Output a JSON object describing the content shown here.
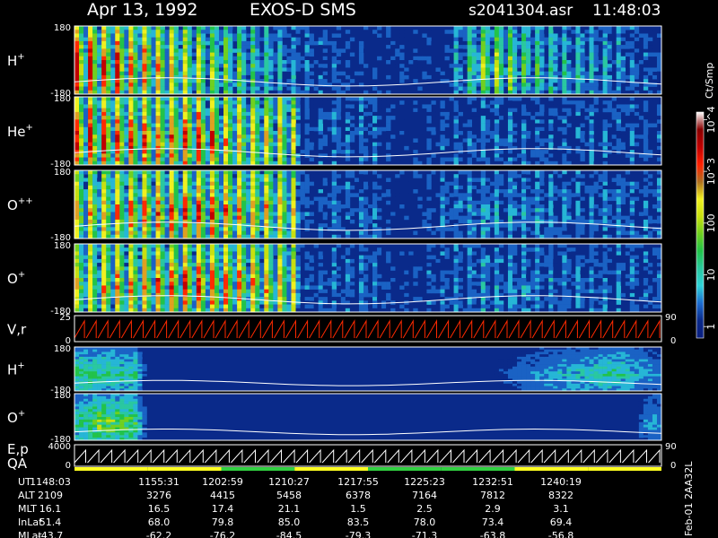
{
  "header": {
    "date": "Apr 13, 1992",
    "instrument": "EXOS-D SMS",
    "file": "s2041304.asr",
    "time": "11:48:03"
  },
  "colors": {
    "background": "#000000",
    "spectrogram_bg": "#0a2a8a",
    "trace": "#ffffff",
    "line_red": "#ff2a00"
  },
  "colorbar": {
    "unit": "Ct/Smp",
    "ticks": [
      {
        "label": "1",
        "value": 1
      },
      {
        "label": "10",
        "value": 10
      },
      {
        "label": "100",
        "value": 100
      },
      {
        "label": "10^3",
        "value": 1000
      },
      {
        "label": "10^4",
        "value": 10000
      }
    ],
    "range": [
      0.6,
      14000
    ],
    "stops": [
      "#0a1f80",
      "#0a2a8a",
      "#1d6cd0",
      "#2fd2d8",
      "#2ac8a0",
      "#22c34a",
      "#70d020",
      "#c8e010",
      "#f0f020",
      "#b07020",
      "#ff2000",
      "#c00000",
      "#880000",
      "#ffffff"
    ]
  },
  "chart_data": {
    "type": "heatmap",
    "x_time_labels": [
      "1148:03",
      "1155:31",
      "1202:59",
      "1210:27",
      "1217:55",
      "1225:23",
      "1232:51",
      "1240:19"
    ],
    "ephemeris": [
      {
        "label": "UT",
        "values": [
          "1148:03",
          "1155:31",
          "1202:59",
          "1210:27",
          "1217:55",
          "1225:23",
          "1232:51",
          "1240:19"
        ]
      },
      {
        "label": "ALT",
        "values": [
          "2109",
          "3276",
          "4415",
          "5458",
          "6378",
          "7164",
          "7812",
          "8322"
        ]
      },
      {
        "label": "MLT",
        "values": [
          "16.1",
          "16.5",
          "17.4",
          "21.1",
          "1.5",
          "2.5",
          "2.9",
          "3.1"
        ]
      },
      {
        "label": "InLat",
        "values": [
          "51.4",
          "68.0",
          "79.8",
          "85.0",
          "83.5",
          "78.0",
          "73.4",
          "69.4"
        ]
      },
      {
        "label": "MLat",
        "values": [
          "-43.7",
          "-62.2",
          "-76.2",
          "-84.5",
          "-79.3",
          "-71.3",
          "-63.8",
          "-56.8"
        ]
      }
    ],
    "panels": [
      {
        "label": "H",
        "sup": "+",
        "ytop": "180",
        "ybot": "-180",
        "kind": "spec",
        "profile": [
          [
            0.0,
            0.85
          ],
          [
            0.15,
            0.65
          ],
          [
            0.3,
            0.35
          ],
          [
            0.38,
            0.15
          ],
          [
            0.5,
            0.04
          ],
          [
            0.56,
            0.08
          ],
          [
            0.62,
            0.02
          ],
          [
            0.7,
            0.55
          ],
          [
            0.8,
            0.3
          ],
          [
            0.92,
            0.2
          ],
          [
            1.0,
            0.05
          ]
        ]
      },
      {
        "label": "He",
        "sup": "+",
        "ytop": "180",
        "ybot": "-180",
        "kind": "spec",
        "profile": [
          [
            0.0,
            0.8
          ],
          [
            0.15,
            0.7
          ],
          [
            0.2,
            0.8
          ],
          [
            0.25,
            0.65
          ],
          [
            0.37,
            0.55
          ],
          [
            0.38,
            0.1
          ],
          [
            0.5,
            0.15
          ],
          [
            0.55,
            0.02
          ],
          [
            0.68,
            0.15
          ],
          [
            1.0,
            0.1
          ]
        ]
      },
      {
        "label": "O",
        "sup": "++",
        "ytop": "180",
        "ybot": "-180",
        "kind": "spec",
        "profile": [
          [
            0.0,
            0.6
          ],
          [
            0.2,
            0.75
          ],
          [
            0.25,
            0.7
          ],
          [
            0.37,
            0.6
          ],
          [
            0.38,
            0.1
          ],
          [
            0.5,
            0.15
          ],
          [
            0.55,
            0.02
          ],
          [
            0.68,
            0.2
          ],
          [
            1.0,
            0.12
          ]
        ]
      },
      {
        "label": "O",
        "sup": "+",
        "ytop": "180",
        "ybot": "-180",
        "kind": "spec",
        "profile": [
          [
            0.0,
            0.6
          ],
          [
            0.2,
            0.75
          ],
          [
            0.25,
            0.7
          ],
          [
            0.37,
            0.6
          ],
          [
            0.38,
            0.1
          ],
          [
            0.5,
            0.15
          ],
          [
            0.55,
            0.02
          ],
          [
            0.68,
            0.2
          ],
          [
            1.0,
            0.12
          ]
        ]
      },
      {
        "label": "V,r",
        "sup": "",
        "ytop": "25",
        "ybot": "0",
        "kind": "sawtooth",
        "right_top": "90",
        "right_bot": "0"
      },
      {
        "label": "H",
        "sup": "+",
        "ytop": "180",
        "ybot": "-180",
        "kind": "spec2",
        "profile": [
          [
            0.0,
            0.4
          ],
          [
            0.1,
            0.35
          ],
          [
            0.12,
            0.05
          ],
          [
            0.7,
            0.05
          ],
          [
            0.82,
            0.25
          ],
          [
            0.92,
            0.35
          ],
          [
            0.98,
            0.2
          ],
          [
            1.0,
            0.15
          ]
        ]
      },
      {
        "label": "O",
        "sup": "+",
        "ytop": "180",
        "ybot": "-180",
        "kind": "spec3",
        "profile": [
          [
            0.0,
            0.35
          ],
          [
            0.04,
            0.55
          ],
          [
            0.1,
            0.45
          ],
          [
            0.12,
            0.05
          ],
          [
            0.95,
            0.05
          ],
          [
            0.98,
            0.25
          ],
          [
            1.0,
            0.2
          ]
        ]
      },
      {
        "label": "E,p",
        "sup": "",
        "label2": "QA",
        "ytop": "4000",
        "ybot": "0",
        "kind": "sawtooth2",
        "right_top": "90",
        "right_bot": "0"
      }
    ]
  },
  "footer": {
    "vertical_label": "Feb-01 2AA32L"
  }
}
